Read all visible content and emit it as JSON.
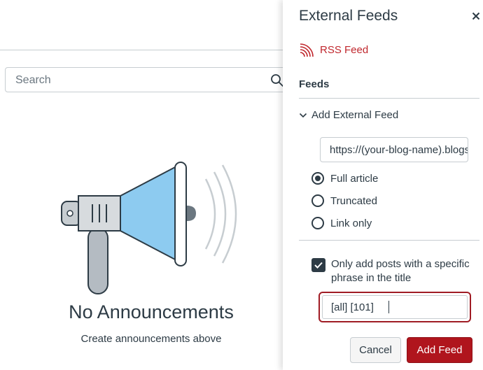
{
  "background": {
    "search": {
      "placeholder": "Search",
      "icon": "search-icon"
    },
    "empty_state": {
      "title": "No Announcements",
      "subtitle": "Create announcements above",
      "illustration": "megaphone"
    }
  },
  "tray": {
    "title": "External Feeds",
    "close_icon": "close-icon",
    "rss_link": "RSS Feed",
    "feeds_heading": "Feeds",
    "add_external_feed": "Add External Feed",
    "url_value": "https://(your-blog-name).blogspot.com",
    "options": [
      {
        "label": "Full article",
        "checked": true
      },
      {
        "label": "Truncated",
        "checked": false
      },
      {
        "label": "Link only",
        "checked": false
      }
    ],
    "phrase_checkbox": {
      "label": "Only add posts with a specific phrase in the title",
      "checked": true
    },
    "phrase_value": "[all] [101]",
    "cancel_label": "Cancel",
    "add_feed_label": "Add Feed",
    "colors": {
      "accent": "#b0151d",
      "link": "#c0272d",
      "text": "#2d3b45"
    }
  }
}
